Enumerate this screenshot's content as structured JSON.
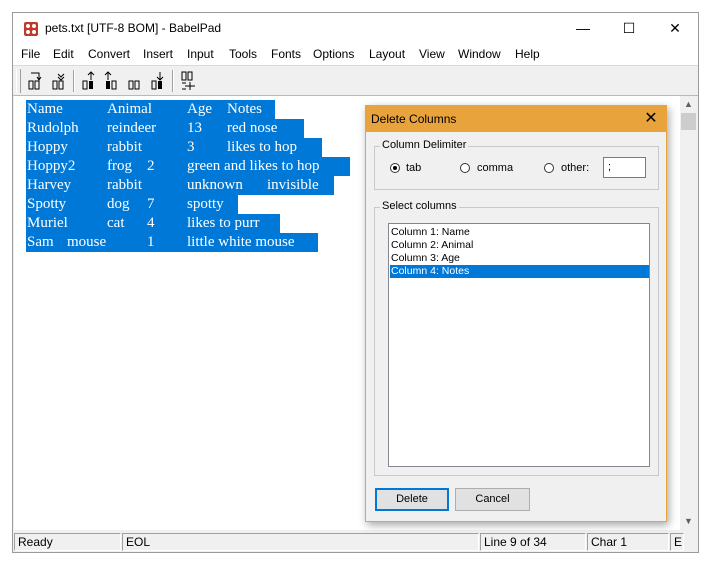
{
  "window": {
    "title": "pets.txt [UTF-8 BOM] - BabelPad",
    "minimize": "—",
    "maximize": "☐",
    "close": "✕"
  },
  "menu": [
    "File",
    "Edit",
    "Convert",
    "Insert",
    "Input",
    "Tools",
    "Fonts",
    "Options",
    "Layout",
    "View",
    "Window",
    "Help"
  ],
  "editor": {
    "lines": [
      {
        "cols": [
          "Name",
          "Animal",
          "Age",
          "Notes"
        ]
      },
      {
        "cols": [
          "Rudolph",
          "reindeer",
          "13",
          "red nose"
        ]
      },
      {
        "cols": [
          "Hoppy",
          "rabbit",
          "3",
          "likes to hop"
        ]
      },
      {
        "cols": [
          "Hoppy2",
          "frog",
          "2",
          "green and likes to hop"
        ]
      },
      {
        "cols": [
          "Harvey",
          "rabbit",
          "unknown",
          "invisible"
        ]
      },
      {
        "cols": [
          "Spotty",
          "dog",
          "7",
          "spotty"
        ]
      },
      {
        "cols": [
          "Muriel",
          "cat",
          "4",
          "likes to purr"
        ]
      },
      {
        "cols": [
          "Sam",
          "mouse",
          "1",
          "little white mouse"
        ]
      }
    ],
    "selection_color": "#0078d7"
  },
  "status": {
    "state": "Ready",
    "eol": "EOL",
    "line": "Line 9 of 34",
    "char": "Char 1",
    "extra": "E"
  },
  "dialog": {
    "title": "Delete Columns",
    "delimiter_group": "Column Delimiter",
    "options": {
      "tab": "tab",
      "comma": "comma",
      "other": "other:"
    },
    "selected_delimiter": "tab",
    "other_value": ";",
    "columns_group": "Select columns",
    "columns": [
      "Column 1: Name",
      "Column 2: Animal",
      "Column 3: Age",
      "Column 4: Notes"
    ],
    "selected_column": "Column 4: Notes",
    "delete_button": "Delete",
    "cancel_button": "Cancel",
    "accent_color": "#e8a33c"
  }
}
